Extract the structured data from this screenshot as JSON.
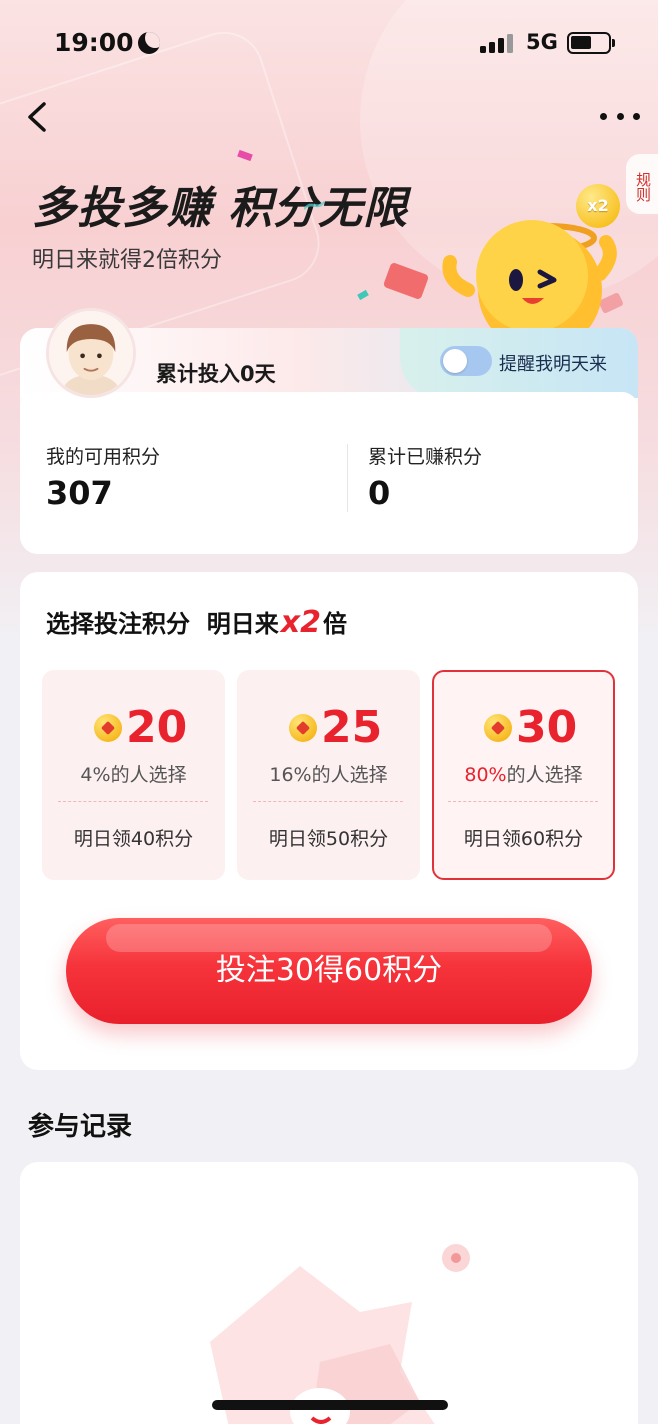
{
  "status_bar": {
    "time": "19:00",
    "network": "5G"
  },
  "header": {
    "rules_label": "规则"
  },
  "hero": {
    "headline_part1": "多投多赚",
    "headline_part2": "积分无限",
    "subline": "明日来就得2倍积分",
    "badge": "x2"
  },
  "user": {
    "days_label": "累计投入0天",
    "remind_label": "提醒我明天来",
    "remind_on": false,
    "available_points_label": "我的可用积分",
    "available_points": "307",
    "earned_points_label": "累计已赚积分",
    "earned_points": "0"
  },
  "bet": {
    "title_prefix": "选择投注积分  明日来",
    "title_multiplier": "x2",
    "title_suffix": "倍",
    "options": [
      {
        "value": "20",
        "pct": "4%",
        "pct_suffix": "的人选择",
        "reward": "明日领40积分",
        "selected": false
      },
      {
        "value": "25",
        "pct": "16%",
        "pct_suffix": "的人选择",
        "reward": "明日领50积分",
        "selected": false
      },
      {
        "value": "30",
        "pct": "80%",
        "pct_suffix": "的人选择",
        "reward": "明日领60积分",
        "selected": true
      }
    ],
    "button_label": "投注30得60积分"
  },
  "records": {
    "title": "参与记录"
  },
  "colors": {
    "accent": "#e8232e",
    "page_bg": "#f1f0f4",
    "toggle": "#a6c8f0"
  }
}
